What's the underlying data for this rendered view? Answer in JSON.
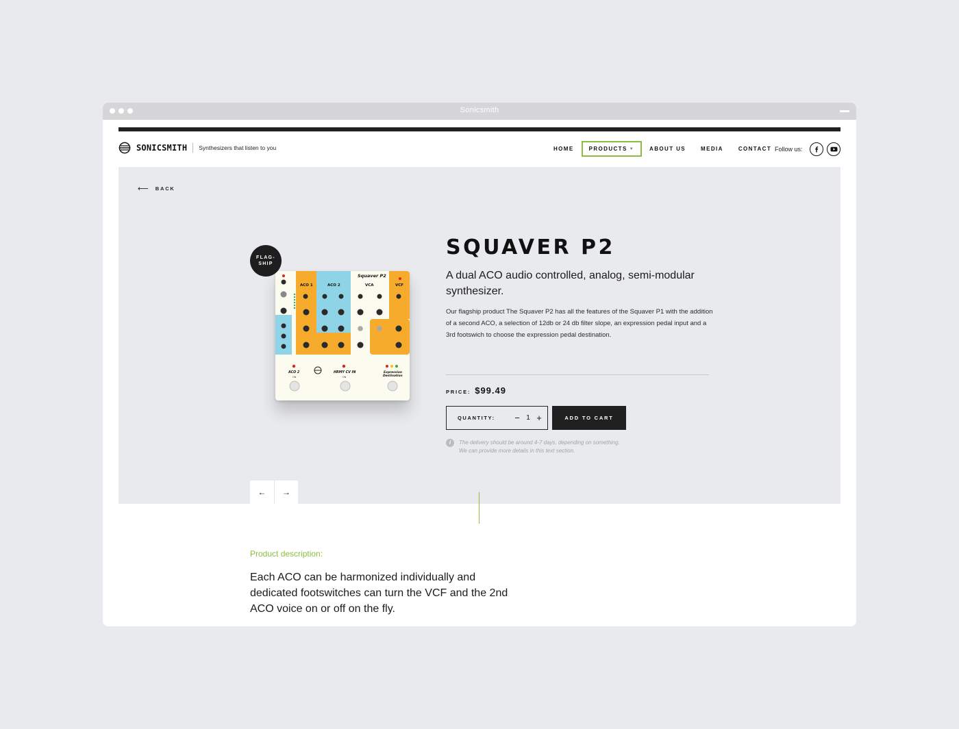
{
  "window": {
    "title": "Sonicsmith"
  },
  "header": {
    "brand": "SONICSMITH",
    "tagline": "Synthesizers that listen to you",
    "nav": [
      {
        "label": "HOME",
        "active": false
      },
      {
        "label": "PRODUCTS",
        "active": true,
        "has_dropdown": true
      },
      {
        "label": "ABOUT US",
        "active": false
      },
      {
        "label": "MEDIA",
        "active": false
      },
      {
        "label": "CONTACT",
        "active": false
      }
    ],
    "follow_label": "Follow us:",
    "social_icons": [
      "facebook-icon",
      "youtube-icon"
    ]
  },
  "hero": {
    "back_label": "BACK",
    "badge": {
      "line1": "FLAG-",
      "line2": "SHIP"
    },
    "pedal_labels": {
      "brand": "Squaver P2",
      "aco1": "ACO 1",
      "aco2": "ACO 2",
      "vca": "VCA",
      "vcf": "VCF",
      "footswitch_left": "ACO 2",
      "footswitch_middle": "HRMY CV IN",
      "footswitch_right_1": "Expression",
      "footswitch_right_2": "Destination",
      "on": "ON"
    },
    "product": {
      "title": "SQUAVER P2",
      "subtitle": "A dual ACO audio controlled, analog, semi-modular synthesizer.",
      "description": "Our flagship product The Squaver P2 has all the features of the Squaver P1 with the addition of a second ACO, a selection of 12db or 24 db filter slope, an expression pedal input and a 3rd footswich to choose the expression pedal destination.",
      "price_label": "PRICE:",
      "price": "$99.49",
      "quantity_label": "QUANTITY:",
      "quantity": "1",
      "minus": "−",
      "plus": "+",
      "add_to_cart": "ADD TO CART",
      "delivery_line1": "The delivery should be around 4-7 days, depending on something.",
      "delivery_line2": "We can provide more details in this text section."
    },
    "gallery_prev": "←",
    "gallery_next": "→"
  },
  "details": {
    "label": "Product description:",
    "body": "Each ACO can be harmonized individually and dedicated footswitches can turn the VCF and the 2nd ACO voice on or off on the fly."
  },
  "colors": {
    "accent_green": "#8bbd3e",
    "pedal_orange": "#f6ab2d",
    "pedal_blue": "#8fd3e6",
    "pedal_cream": "#fbfbef",
    "dark": "#202020"
  }
}
